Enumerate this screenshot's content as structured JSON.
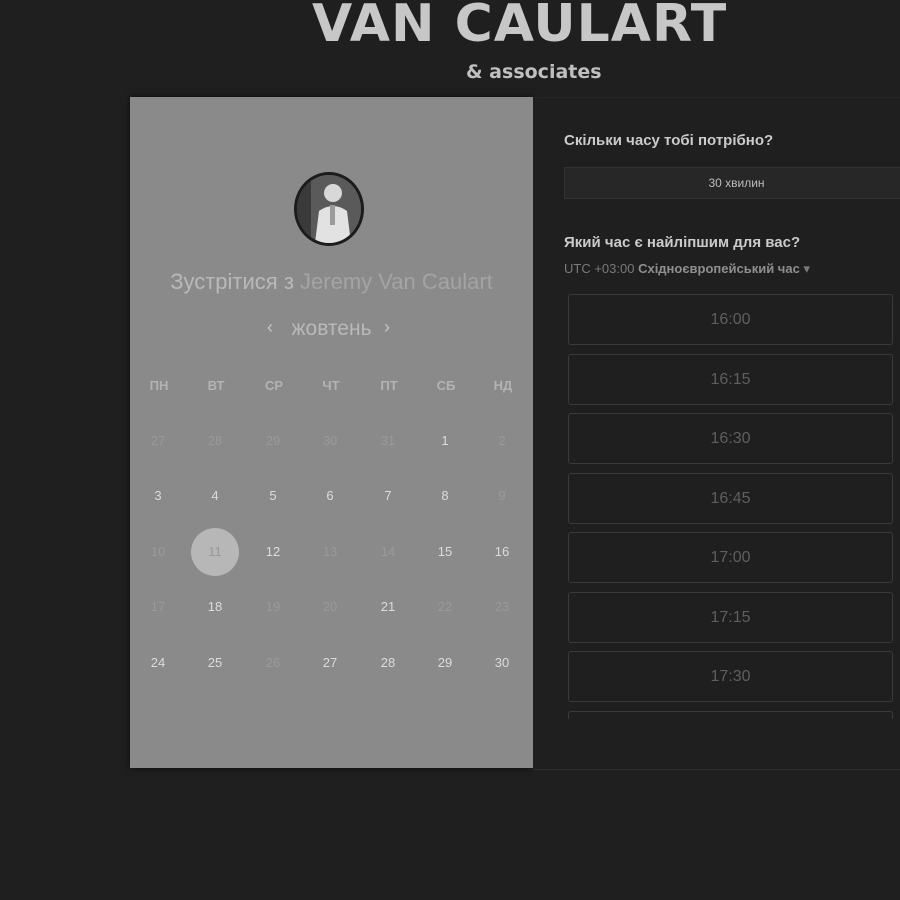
{
  "brand": {
    "name": "VAN CAULART",
    "sub": "& associates"
  },
  "meeting": {
    "prefix": "Зустрітися з",
    "host": "Jeremy Van Caulart"
  },
  "calendar": {
    "prev_icon": "‹",
    "next_icon": "›",
    "month": "жовтень",
    "weekdays": [
      "ПН",
      "ВТ",
      "СР",
      "ЧТ",
      "ПТ",
      "СБ",
      "НД"
    ],
    "weeks": [
      [
        {
          "d": "27",
          "a": false
        },
        {
          "d": "28",
          "a": false
        },
        {
          "d": "29",
          "a": false
        },
        {
          "d": "30",
          "a": false
        },
        {
          "d": "31",
          "a": false
        },
        {
          "d": "1",
          "a": true
        },
        {
          "d": "2",
          "a": false
        }
      ],
      [
        {
          "d": "3",
          "a": true
        },
        {
          "d": "4",
          "a": true
        },
        {
          "d": "5",
          "a": true
        },
        {
          "d": "6",
          "a": true
        },
        {
          "d": "7",
          "a": true
        },
        {
          "d": "8",
          "a": true
        },
        {
          "d": "9",
          "a": false
        }
      ],
      [
        {
          "d": "10",
          "a": false
        },
        {
          "d": "11",
          "a": true,
          "sel": true
        },
        {
          "d": "12",
          "a": true
        },
        {
          "d": "13",
          "a": false
        },
        {
          "d": "14",
          "a": false
        },
        {
          "d": "15",
          "a": true
        },
        {
          "d": "16",
          "a": true
        }
      ],
      [
        {
          "d": "17",
          "a": false
        },
        {
          "d": "18",
          "a": true
        },
        {
          "d": "19",
          "a": false
        },
        {
          "d": "20",
          "a": false
        },
        {
          "d": "21",
          "a": true
        },
        {
          "d": "22",
          "a": false
        },
        {
          "d": "23",
          "a": false
        }
      ],
      [
        {
          "d": "24",
          "a": true
        },
        {
          "d": "25",
          "a": true
        },
        {
          "d": "26",
          "a": false
        },
        {
          "d": "27",
          "a": true
        },
        {
          "d": "28",
          "a": true
        },
        {
          "d": "29",
          "a": true
        },
        {
          "d": "30",
          "a": true
        }
      ]
    ]
  },
  "duration": {
    "question": "Скільки часу тобі потрібно?",
    "value": "30 хвилин"
  },
  "time": {
    "question": "Який час є найліпшим для вас?",
    "tz_offset": "UTC +03:00",
    "tz_name": "Східноєвропейський час",
    "tz_caret": "▾",
    "slots": [
      "16:00",
      "16:15",
      "16:30",
      "16:45",
      "17:00",
      "17:15",
      "17:30",
      ""
    ]
  }
}
